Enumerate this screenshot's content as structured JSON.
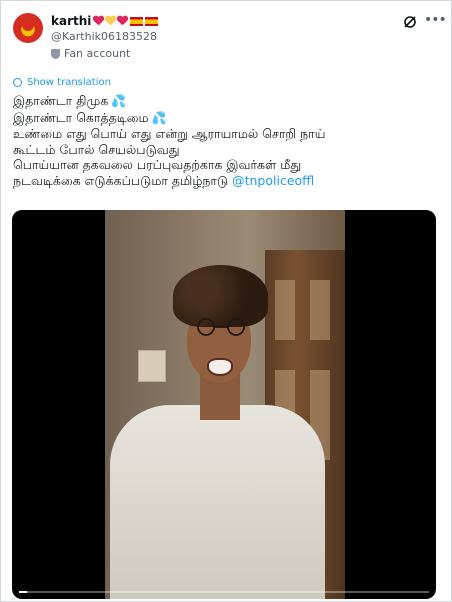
{
  "tweet": {
    "display_name": "karthi",
    "name_emojis": [
      "red-heart",
      "yellow-heart",
      "red-heart",
      "spain-flag",
      "spain-flag"
    ],
    "handle": "@Karthik06183528",
    "account_label": "Fan account",
    "show_translation": "Show translation",
    "lines": [
      "இதாண்டா திமுக",
      "இதாண்டா கொத்தடிமை",
      "உண்மை எது பொய் எது என்று ஆராயாமல் சொறி நாய்",
      "கூட்டம் போல் செயல்படுவது",
      "பொய்யான தகவலை பரப்புவதற்காக இவர்கள் மீது",
      "நடவடிக்கை எடுக்கப்படுமா தமிழ்நாடு"
    ],
    "mention": "@tnpoliceoffl",
    "video_progress": 0.02
  },
  "icons": {
    "translate": "grok-translate-icon",
    "more": "more-options-icon",
    "sweat_drops": "sweat-droplets-icon"
  },
  "colors": {
    "accent": "#1d9bf0",
    "text": "#0f1419",
    "muted": "#536471"
  }
}
